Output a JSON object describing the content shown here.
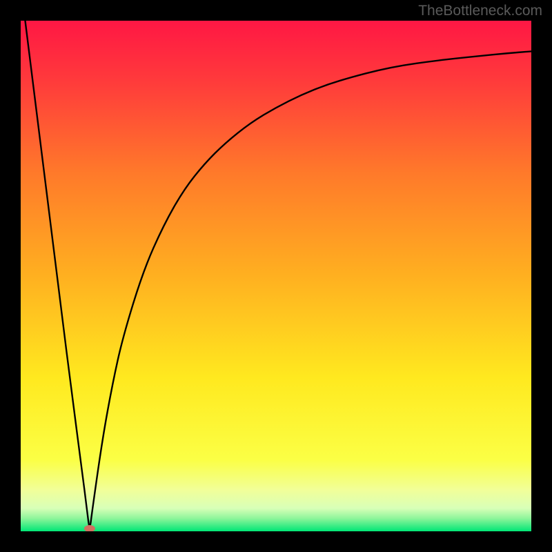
{
  "watermark": "TheBottleneck.com",
  "chart_data": {
    "type": "line",
    "title": "",
    "xlabel": "",
    "ylabel": "",
    "xlim": [
      0,
      100
    ],
    "ylim": [
      0,
      100
    ],
    "series": [
      {
        "name": "bottleneck-curve",
        "x": [
          0,
          2,
          4,
          6,
          8,
          10,
          12,
          13,
          13.5,
          14,
          16,
          18,
          20,
          24,
          28,
          32,
          36,
          40,
          45,
          50,
          55,
          60,
          65,
          70,
          75,
          80,
          85,
          90,
          95,
          100
        ],
        "values": [
          107,
          91,
          75,
          59,
          43,
          27,
          12,
          4,
          0,
          4,
          18,
          29,
          38,
          51,
          60,
          67,
          72,
          76,
          80,
          83,
          85.5,
          87.5,
          89,
          90.3,
          91.3,
          92,
          92.6,
          93.1,
          93.6,
          94
        ]
      }
    ],
    "marker": {
      "name": "optimal-point",
      "x": 13.5,
      "y": 0,
      "color": "#d07060"
    },
    "gradient": {
      "stops": [
        {
          "offset": 0.0,
          "color": "#ff1744"
        },
        {
          "offset": 0.12,
          "color": "#ff3b3b"
        },
        {
          "offset": 0.3,
          "color": "#ff7a2a"
        },
        {
          "offset": 0.5,
          "color": "#ffb020"
        },
        {
          "offset": 0.7,
          "color": "#ffe91f"
        },
        {
          "offset": 0.86,
          "color": "#fbff45"
        },
        {
          "offset": 0.92,
          "color": "#f1ff9a"
        },
        {
          "offset": 0.955,
          "color": "#d8ffb8"
        },
        {
          "offset": 0.975,
          "color": "#8cf59a"
        },
        {
          "offset": 1.0,
          "color": "#00e676"
        }
      ]
    }
  }
}
